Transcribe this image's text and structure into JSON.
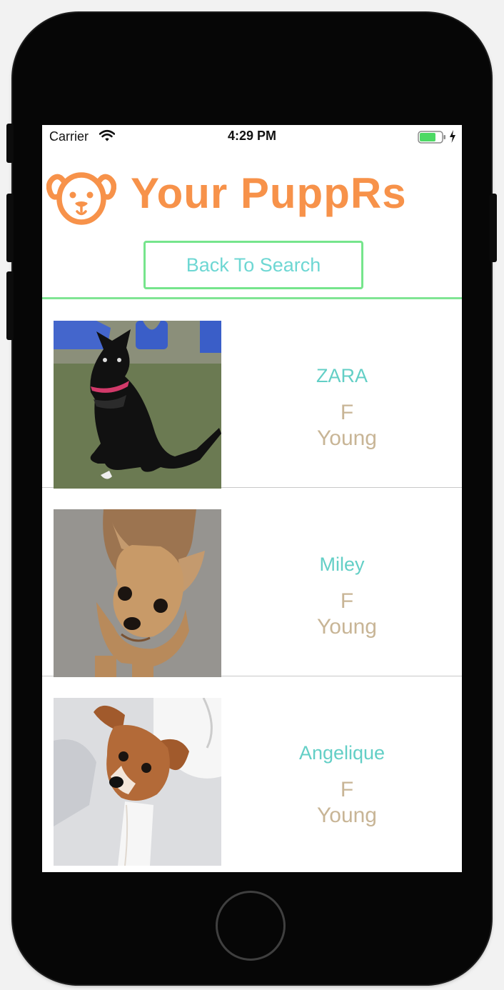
{
  "status_bar": {
    "carrier": "Carrier",
    "time": "4:29 PM"
  },
  "header": {
    "logo_icon": "dog-face-icon",
    "title": "Your PuppRs",
    "accent_color": "#f7924a"
  },
  "back_button": {
    "label": "Back To Search"
  },
  "dogs": [
    {
      "name": "ZARA",
      "sex": "F",
      "age": "Young",
      "photo": "black-dog-photo"
    },
    {
      "name": "Miley",
      "sex": "F",
      "age": "Young",
      "photo": "chihuahua-photo"
    },
    {
      "name": "Angelique",
      "sex": "F",
      "age": "Young",
      "photo": "brown-white-dog-photo"
    }
  ]
}
